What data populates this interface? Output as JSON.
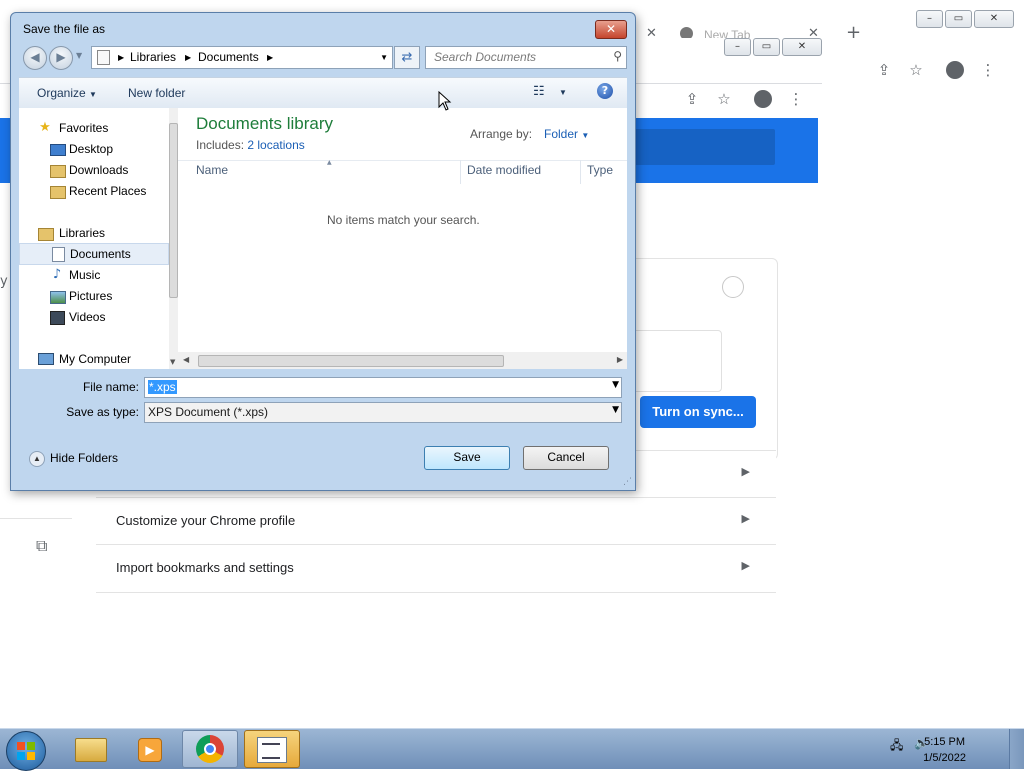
{
  "background": {
    "tab_title": "New Tab",
    "new_tab_symbol": "+",
    "menu_symbol": "⋮",
    "turn_on_sync": "Turn on sync...",
    "rows": [
      "Customize your Chrome profile",
      "Import bookmarks and settings"
    ],
    "left_char": "y"
  },
  "dialog": {
    "title": "Save the file as",
    "breadcrumbs": [
      "Libraries",
      "Documents"
    ],
    "search_placeholder": "Search Documents",
    "toolbar": {
      "organize": "Organize",
      "new_folder": "New folder",
      "help": "?"
    },
    "nav": {
      "favorites": "Favorites",
      "desktop": "Desktop",
      "downloads": "Downloads",
      "recent_places": "Recent Places",
      "libraries": "Libraries",
      "documents": "Documents",
      "music": "Music",
      "pictures": "Pictures",
      "videos": "Videos",
      "my_computer": "My Computer"
    },
    "content": {
      "library_title": "Documents library",
      "includes_label": "Includes:",
      "includes_link": "2 locations",
      "arrange_by_label": "Arrange by:",
      "arrange_by_value": "Folder",
      "columns": [
        "Name",
        "Date modified",
        "Type"
      ],
      "empty_message": "No items match your search."
    },
    "file_name_label": "File name:",
    "file_name_value": "*.xps",
    "save_as_type_label": "Save as type:",
    "save_as_type_value": "XPS Document (*.xps)",
    "hide_folders": "Hide Folders",
    "save_button": "Save",
    "cancel_button": "Cancel"
  },
  "taskbar": {
    "time": "5:15 PM",
    "date": "1/5/2022"
  }
}
